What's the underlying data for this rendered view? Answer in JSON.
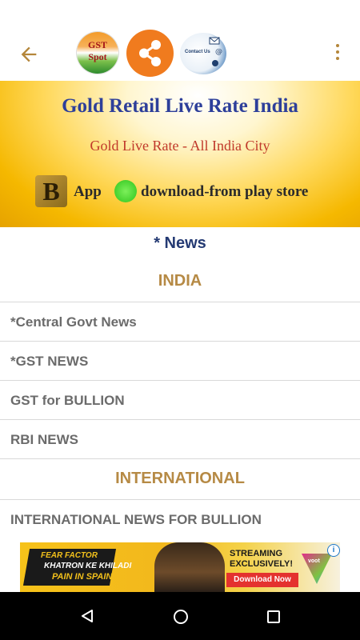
{
  "appbar": {
    "gst_logo_line1": "GST",
    "gst_logo_line2": "Spot",
    "contact_label": "Contact Us",
    "icons": [
      "back-arrow-icon",
      "gst-spot-logo",
      "share-icon",
      "contact-us-icon",
      "more-vert-icon"
    ],
    "accent_color": "#b4863a",
    "share_color": "#f07b1e"
  },
  "banner": {
    "title": "Gold Retail Live Rate India",
    "subtitle": "Gold Live Rate -  All India City",
    "logo_letter": "B",
    "app_text": "App",
    "download_text": "download-from play store"
  },
  "page": {
    "title": "* News",
    "sections": [
      {
        "header": "INDIA",
        "items": [
          "*Central Govt News",
          "*GST NEWS",
          "GST for BULLION",
          "RBI NEWS"
        ]
      },
      {
        "header": "INTERNATIONAL",
        "items": [
          "INTERNATIONAL NEWS FOR BULLION"
        ]
      }
    ]
  },
  "ad": {
    "badge_line1": "FEAR FACTOR",
    "badge_line2": "KHATRON KE KHILADI",
    "badge_line3": "PAIN IN SPAIN",
    "streaming_line1": "STREAMING",
    "streaming_line2": "EXCLUSIVELY!",
    "cta": "Download Now",
    "brand": "voot",
    "info_glyph": "i"
  },
  "navbar": {
    "icons": [
      "nav-back-icon",
      "nav-home-icon",
      "nav-recents-icon"
    ]
  }
}
